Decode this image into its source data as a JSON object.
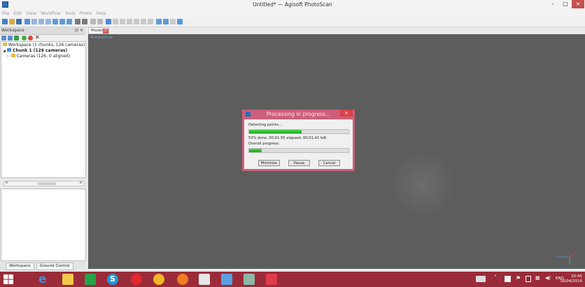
{
  "window": {
    "title": "Untitled* — Agisoft PhotoScan",
    "minimize": "–",
    "maximize": "□",
    "close": "×"
  },
  "menu": [
    "File",
    "Edit",
    "View",
    "Workflow",
    "Tools",
    "Photo",
    "Help"
  ],
  "workspace": {
    "header": "Workspace",
    "header_controls": "⊡ ×",
    "tree": [
      "Workspace (1 chunks, 126 cameras)",
      "Chunk 1 (126 cameras)",
      "Cameras (126, 0 aligned)"
    ],
    "scroll_left": "<",
    "scroll_right": ">"
  },
  "bottom_tabs": [
    "Workspace",
    "Ground Control"
  ],
  "model_tab": {
    "label": "Model",
    "close": "×"
  },
  "viewport": {
    "projection_label": "Perspective"
  },
  "dialog": {
    "title": "Processing in progress...",
    "close": "×",
    "step_label": "Detecting points...",
    "step_progress": 0.53,
    "status": "53% done, 00:01:55 elapsed, 00:01:41 left",
    "overall_label": "Overall progress:",
    "overall_progress": 0.13,
    "buttons": {
      "minimize": "Minimize",
      "pause": "Pause",
      "cancel": "Cancel"
    }
  },
  "taskbar": {
    "language": "ENG",
    "time": "20:45",
    "date": "16/04/2016"
  },
  "colors": {
    "taskbar": "#9a2b39",
    "dialog_accent": "#cc5f7a",
    "progress": "#18a818",
    "viewport": "#5d5d5d"
  }
}
